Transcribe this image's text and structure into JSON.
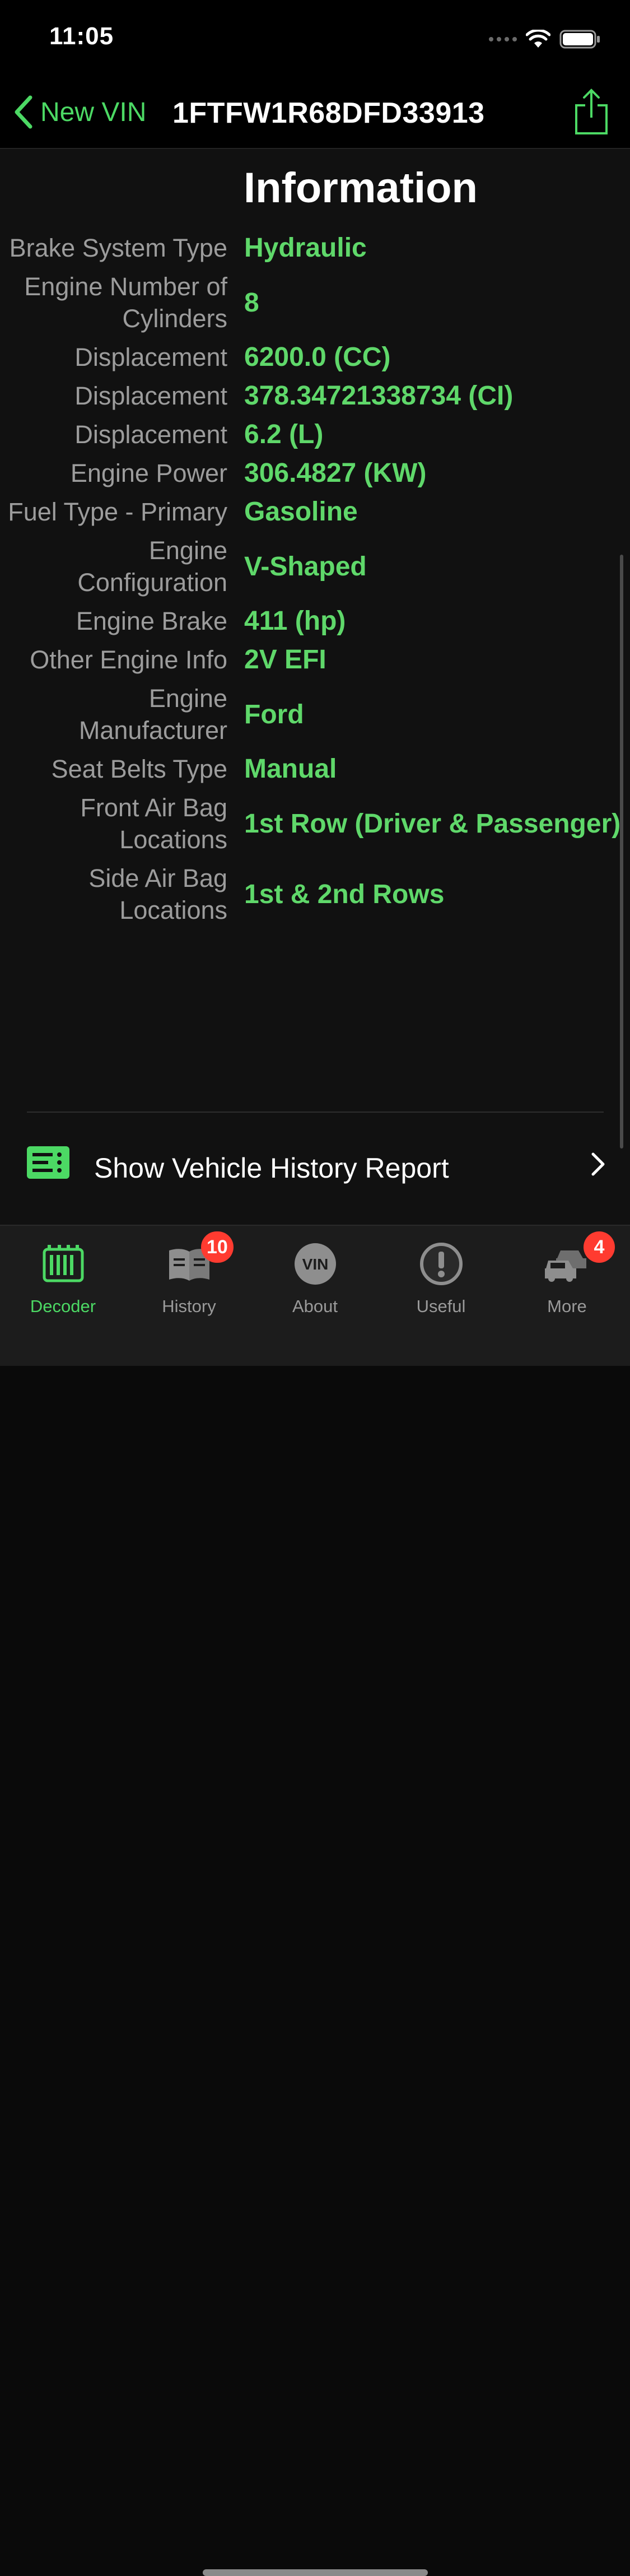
{
  "status": {
    "time": "11:05"
  },
  "nav": {
    "back_label": "New VIN",
    "title": "1FTFW1R68DFD33913"
  },
  "section": {
    "title": "Information"
  },
  "specs": [
    {
      "label": "Brake System Type",
      "value": "Hydraulic"
    },
    {
      "label": "Engine Number of Cylinders",
      "value": "8"
    },
    {
      "label": "Displacement",
      "value": "6200.0 (CC)"
    },
    {
      "label": "Displacement",
      "value": "378.34721338734 (CI)"
    },
    {
      "label": "Displacement",
      "value": "6.2 (L)"
    },
    {
      "label": "Engine Power",
      "value": "306.4827 (KW)"
    },
    {
      "label": "Fuel Type - Primary",
      "value": "Gasoline"
    },
    {
      "label": "Engine Configuration",
      "value": "V-Shaped"
    },
    {
      "label": "Engine Brake",
      "value": "411 (hp)"
    },
    {
      "label": "Other Engine Info",
      "value": "2V EFI"
    },
    {
      "label": "Engine Manufacturer",
      "value": "Ford"
    },
    {
      "label": "Seat Belts Type",
      "value": "Manual"
    },
    {
      "label": "Front Air Bag Locations",
      "value": "1st Row (Driver & Passenger)"
    },
    {
      "label": "Side Air Bag Locations",
      "value": "1st & 2nd Rows"
    }
  ],
  "report": {
    "label": "Show Vehicle History Report",
    "icon": "report-list-icon"
  },
  "tabs": [
    {
      "label": "Decoder",
      "icon": "decoder-icon",
      "badge": ""
    },
    {
      "label": "History",
      "icon": "book-icon",
      "badge": "10"
    },
    {
      "label": "About",
      "icon": "vin-circle-icon",
      "icon_text": "VIN",
      "badge": ""
    },
    {
      "label": "Useful",
      "icon": "exclamation-circle-icon",
      "badge": ""
    },
    {
      "label": "More",
      "icon": "cars-icon",
      "badge": "4"
    }
  ],
  "colors": {
    "accent": "#4cd964",
    "value": "#5fd86a",
    "label": "#9c9c9c",
    "badge": "#ff3b30"
  }
}
